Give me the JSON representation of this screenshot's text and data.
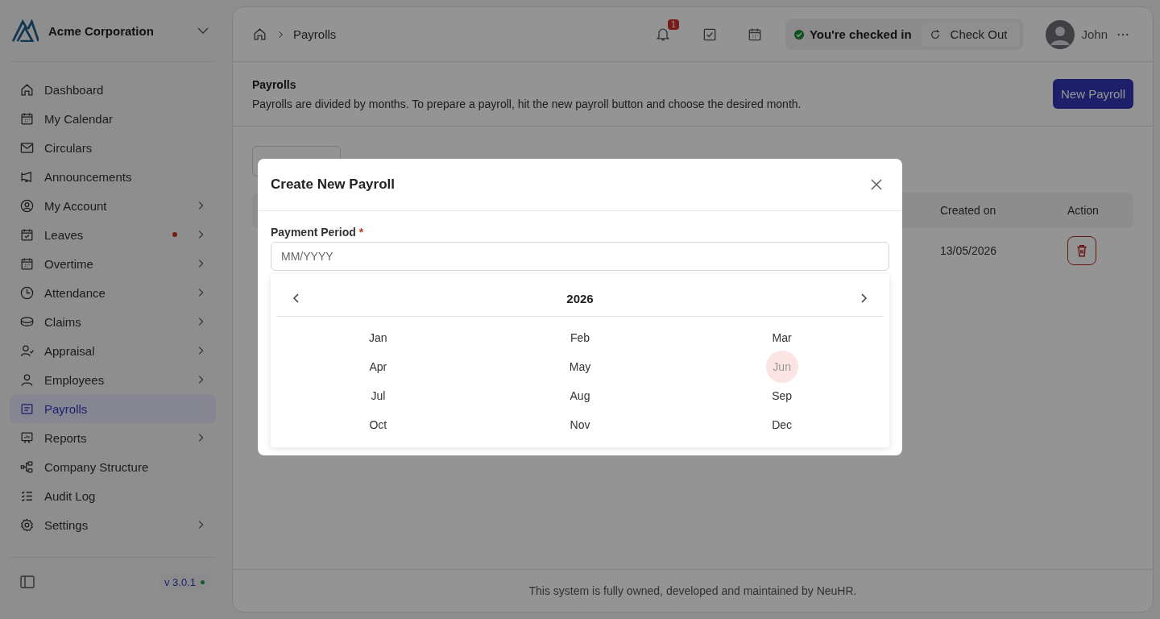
{
  "sidebar": {
    "company": "Acme Corporation",
    "items": [
      {
        "label": "Dashboard",
        "has_submenu": false,
        "selected": false,
        "alert": false
      },
      {
        "label": "My Calendar",
        "has_submenu": false,
        "selected": false,
        "alert": false
      },
      {
        "label": "Circulars",
        "has_submenu": false,
        "selected": false,
        "alert": false
      },
      {
        "label": "Announcements",
        "has_submenu": false,
        "selected": false,
        "alert": false
      },
      {
        "label": "My Account",
        "has_submenu": true,
        "selected": false,
        "alert": false
      },
      {
        "label": "Leaves",
        "has_submenu": true,
        "selected": false,
        "alert": true
      },
      {
        "label": "Overtime",
        "has_submenu": true,
        "selected": false,
        "alert": false
      },
      {
        "label": "Attendance",
        "has_submenu": true,
        "selected": false,
        "alert": false
      },
      {
        "label": "Claims",
        "has_submenu": true,
        "selected": false,
        "alert": false
      },
      {
        "label": "Appraisal",
        "has_submenu": true,
        "selected": false,
        "alert": false
      },
      {
        "label": "Employees",
        "has_submenu": true,
        "selected": false,
        "alert": false
      },
      {
        "label": "Payrolls",
        "has_submenu": false,
        "selected": true,
        "alert": false
      },
      {
        "label": "Reports",
        "has_submenu": true,
        "selected": false,
        "alert": false
      },
      {
        "label": "Company Structure",
        "has_submenu": false,
        "selected": false,
        "alert": false
      },
      {
        "label": "Audit Log",
        "has_submenu": false,
        "selected": false,
        "alert": false
      },
      {
        "label": "Settings",
        "has_submenu": true,
        "selected": false,
        "alert": false
      }
    ],
    "version": "v 3.0.1",
    "online": true
  },
  "topbar": {
    "breadcrumb": "Payrolls",
    "notifications": "1",
    "status": "You're checked in",
    "check_out": "Check Out",
    "user": "John"
  },
  "page": {
    "title": "Payrolls",
    "description": "Payrolls are divided by months. To prepare a payroll, hit the new payroll button and choose the desired month.",
    "new_button": "New Payroll"
  },
  "table": {
    "columns": [
      "Created on",
      "Action"
    ],
    "rows": [
      {
        "created_on": "13/05/2026"
      }
    ]
  },
  "footer": "This system is fully owned, developed and maintained by NeuHR.",
  "modal": {
    "title": "Create New Payroll",
    "field_label": "Payment Period",
    "required_mark": "*",
    "placeholder": "MM/YYYY",
    "picker": {
      "year": "2026",
      "months": [
        {
          "label": "Jan",
          "hovered": false
        },
        {
          "label": "Feb",
          "hovered": false
        },
        {
          "label": "Mar",
          "hovered": false
        },
        {
          "label": "Apr",
          "hovered": false
        },
        {
          "label": "May",
          "hovered": false
        },
        {
          "label": "Jun",
          "hovered": true
        },
        {
          "label": "Jul",
          "hovered": false
        },
        {
          "label": "Aug",
          "hovered": false
        },
        {
          "label": "Sep",
          "hovered": false
        },
        {
          "label": "Oct",
          "hovered": false
        },
        {
          "label": "Nov",
          "hovered": false
        },
        {
          "label": "Dec",
          "hovered": false
        }
      ]
    }
  }
}
